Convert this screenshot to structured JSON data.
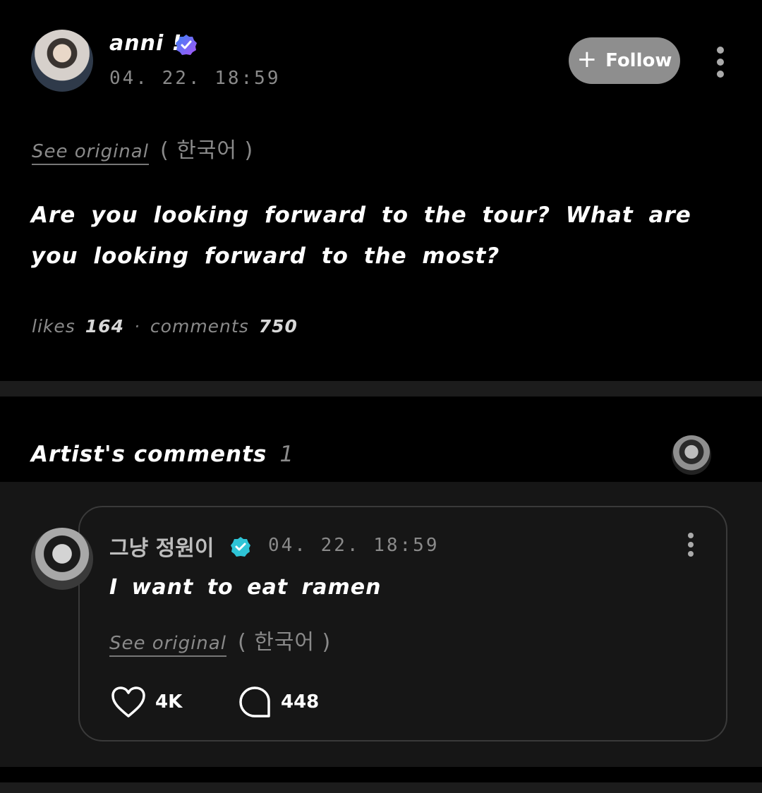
{
  "post": {
    "author": {
      "name": "anni !",
      "badge_icon": "verified-badge-icon"
    },
    "timestamp": "04. 22. 18:59",
    "follow_label": "Follow",
    "see_original_label": "See original",
    "original_language": "( 한국어 )",
    "text": "Are you looking forward to the tour? What are you looking forward to the most?",
    "stats": {
      "likes_label": "likes",
      "likes_value": "164",
      "separator": "·",
      "comments_label": "comments",
      "comments_value": "750"
    }
  },
  "artist_comments": {
    "title": "Artist's comments",
    "count": "1",
    "items": [
      {
        "author": "그냥 정원이",
        "timestamp": "04. 22. 18:59",
        "text": "I want to eat ramen",
        "see_original_label": "See original",
        "original_language": "( 한국어 )",
        "likes": "4K",
        "replies": "448"
      }
    ]
  },
  "colors": {
    "background": "#000000",
    "card_background": "#161616",
    "follow_button": "#8e8e8e",
    "badge_gradient_start": "#3b82f6",
    "badge_gradient_end": "#a855f7",
    "verified_teal": "#2ec4d6"
  }
}
